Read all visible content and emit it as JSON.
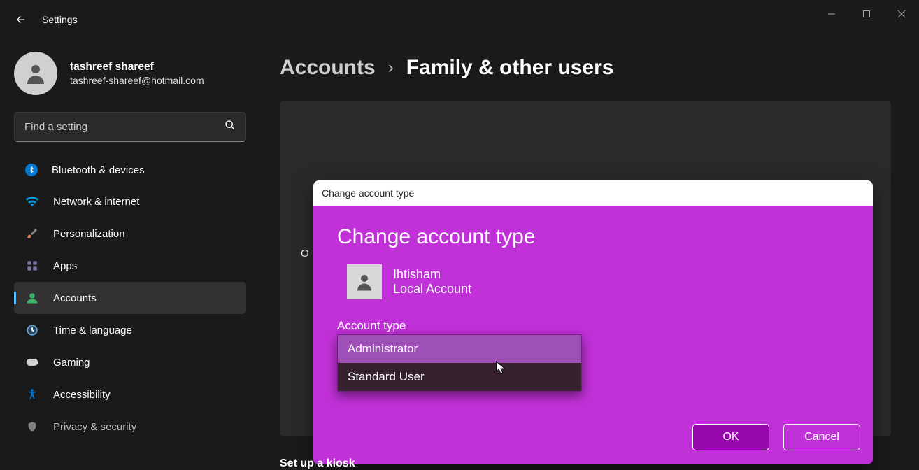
{
  "app": {
    "title": "Settings"
  },
  "profile": {
    "name": "tashreef shareef",
    "email": "tashreef-shareef@hotmail.com"
  },
  "search": {
    "placeholder": "Find a setting"
  },
  "sidebar": {
    "items": [
      {
        "label": "Bluetooth & devices",
        "icon": "bluetooth",
        "color": "#0078d4"
      },
      {
        "label": "Network & internet",
        "icon": "wifi",
        "color": "#0099e6"
      },
      {
        "label": "Personalization",
        "icon": "brush",
        "color": "#d87b4a"
      },
      {
        "label": "Apps",
        "icon": "apps",
        "color": "#7a7a9e"
      },
      {
        "label": "Accounts",
        "icon": "person",
        "color": "#3fb06a",
        "active": true
      },
      {
        "label": "Time & language",
        "icon": "clock",
        "color": "#6aa0d8"
      },
      {
        "label": "Gaming",
        "icon": "gamepad",
        "color": "#d9d9d9"
      },
      {
        "label": "Accessibility",
        "icon": "accessibility",
        "color": "#0078d4"
      },
      {
        "label": "Privacy & security",
        "icon": "shield",
        "color": "#8a8a8a"
      }
    ]
  },
  "breadcrumb": {
    "parent": "Accounts",
    "current": "Family & other users"
  },
  "content": {
    "other_o": "O",
    "kiosk": "Set up a kiosk"
  },
  "dialog": {
    "title_bar": "Change account type",
    "heading": "Change account type",
    "user": {
      "name": "Ihtisham",
      "type": "Local Account"
    },
    "field_label": "Account type",
    "options": {
      "admin": "Administrator",
      "standard": "Standard User"
    },
    "buttons": {
      "ok": "OK",
      "cancel": "Cancel"
    }
  }
}
